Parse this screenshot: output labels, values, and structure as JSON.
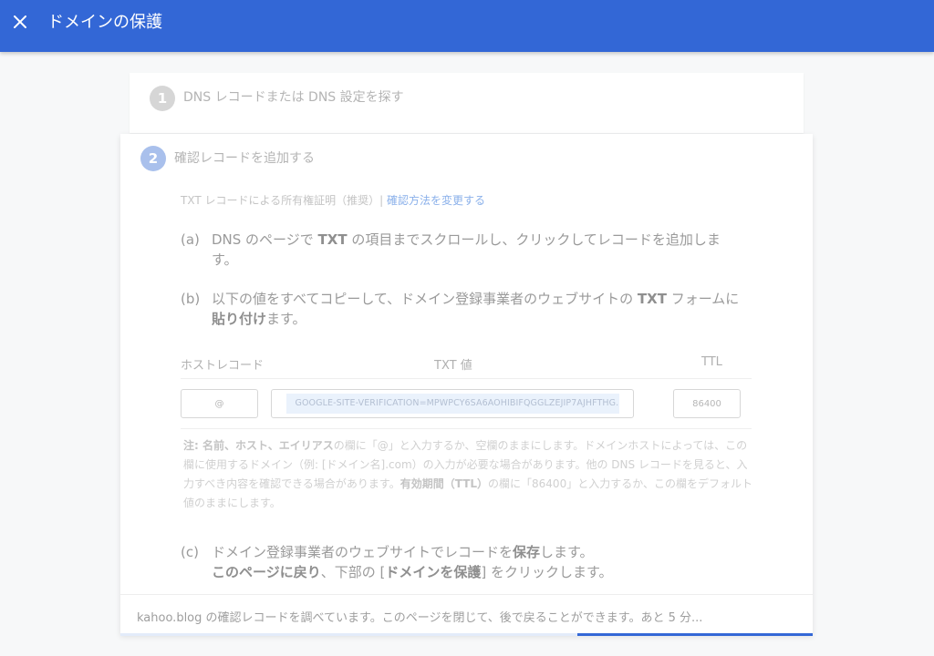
{
  "appbar": {
    "title": "ドメインの保護",
    "close_icon": "close-icon"
  },
  "step1": {
    "number": "1",
    "title": "DNS レコードまたは DNS 設定を探す"
  },
  "step2": {
    "number": "2",
    "title": "確認レコードを追加する",
    "method_label": "TXT レコードによる所有権証明（推奨）|",
    "method_link": "確認方法を変更する",
    "instr_a": {
      "marker": "(a)",
      "t1": "DNS のページで ",
      "b1": "TXT",
      "t2": " の項目までスクロールし、クリックしてレコードを追加します。"
    },
    "instr_b": {
      "marker": "(b)",
      "t1": "以下の値をすべてコピーして、ドメイン登録事業者のウェブサイトの ",
      "b1": "TXT",
      "t2": " フォームに",
      "b2": "貼り付け",
      "t3": "ます。"
    },
    "table": {
      "col_host": "ホストレコード",
      "col_txt": "TXT 値",
      "col_ttl": "TTL",
      "host_value": "@",
      "txt_value": "GOOGLE-SITE-VERIFICATION=MPWPCY6SA6AOHIBIFQGGLZEJIP7AJHFTHG...",
      "ttl_value": "86400"
    },
    "note": {
      "b1": "注: 名前、ホスト、エイリアス",
      "t1": "の欄に「@」と入力するか、空欄のままにします。ドメインホストによっては、この欄に使用するドメイン（例: [ドメイン名].com）の入力が必要な場合があります。他の DNS レコードを見ると、入力すべき内容を確認できる場合があります。",
      "b2": "有効期間（TTL）",
      "t2": "の欄に「86400」と入力するか、この欄をデフォルト値のままにします。"
    },
    "instr_c": {
      "marker": "(c)",
      "t1": "ドメイン登録事業者のウェブサイトでレコードを",
      "b1": "保存",
      "t2": "します。",
      "b2": "このページに戻り",
      "t3": "、下部の [",
      "b3": "ドメインを保護",
      "t4": "] をクリックします。"
    }
  },
  "status": {
    "text": "kahoo.blog の確認レコードを調べています。このページを閉じて、後で戻ることができます。あと 5 分...",
    "progress_fraction": 0.34
  },
  "colors": {
    "primary": "#3367d6",
    "progress_track": "#e3ebfa"
  }
}
